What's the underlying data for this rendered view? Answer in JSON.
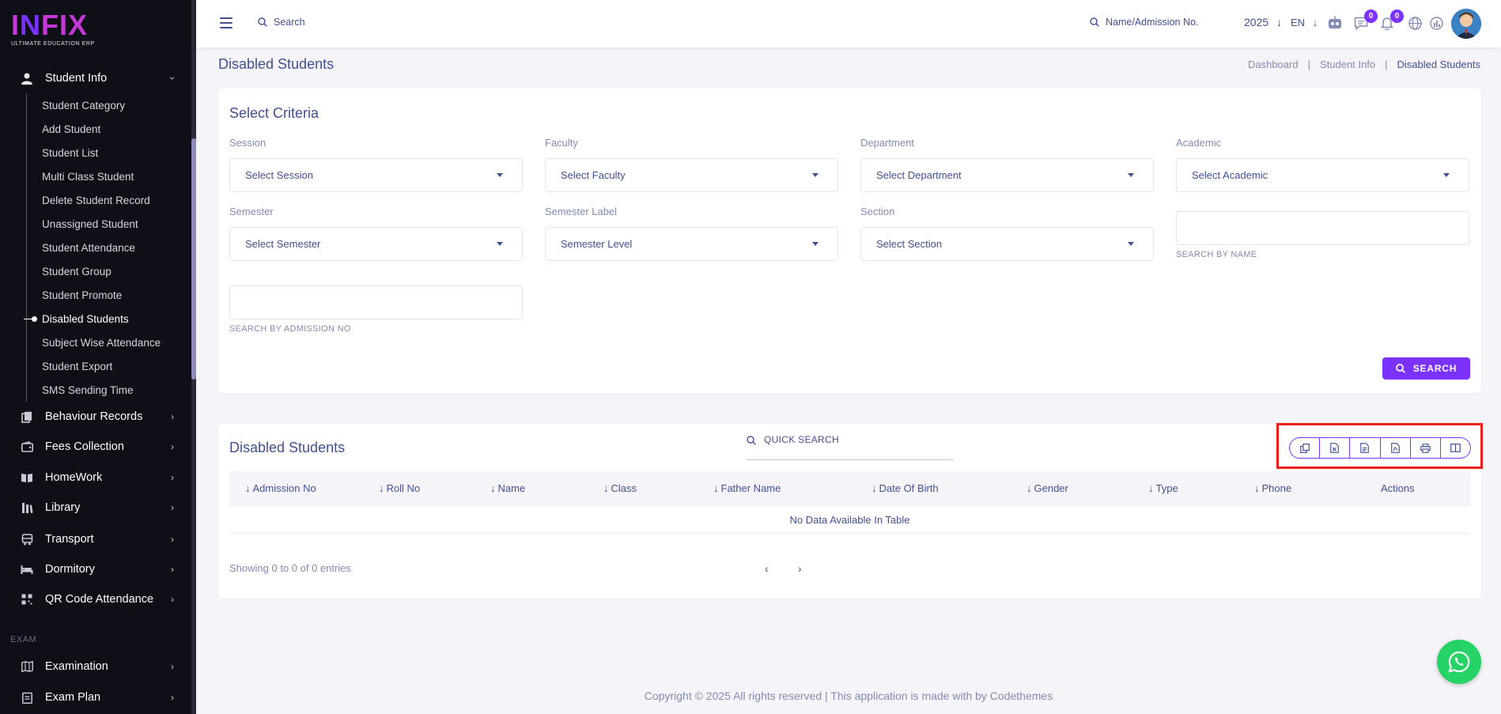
{
  "brand": {
    "logo_text": "INFIX",
    "tagline": "ULTIMATE EDUCATION ERP"
  },
  "sidebar": {
    "student_info": {
      "label": "Student Info",
      "icon": "user-icon"
    },
    "sub_items": [
      {
        "label": "Student Category"
      },
      {
        "label": "Add Student"
      },
      {
        "label": "Student List"
      },
      {
        "label": "Multi Class Student"
      },
      {
        "label": "Delete Student Record"
      },
      {
        "label": "Unassigned Student"
      },
      {
        "label": "Student Attendance"
      },
      {
        "label": "Student Group"
      },
      {
        "label": "Student Promote"
      },
      {
        "label": "Disabled Students",
        "active": true
      },
      {
        "label": "Subject Wise Attendance"
      },
      {
        "label": "Student Export"
      },
      {
        "label": "SMS Sending Time"
      }
    ],
    "menus": [
      {
        "label": "Behaviour Records",
        "icon": "copy-icon"
      },
      {
        "label": "Fees Collection",
        "icon": "wallet-icon"
      },
      {
        "label": "HomeWork",
        "icon": "book-icon"
      },
      {
        "label": "Library",
        "icon": "library-icon"
      },
      {
        "label": "Transport",
        "icon": "bus-icon"
      },
      {
        "label": "Dormitory",
        "icon": "bed-icon"
      },
      {
        "label": "QR Code Attendance",
        "icon": "qr-icon"
      }
    ],
    "section_exam": "EXAM",
    "exam_menus": [
      {
        "label": "Examination",
        "icon": "map-icon"
      },
      {
        "label": "Exam Plan",
        "icon": "clipboard-icon"
      }
    ]
  },
  "header": {
    "search_label": "Search",
    "student_search_label": "Name/Admission No.",
    "year": "2025",
    "language": "EN",
    "chat_badge": "0",
    "notification_badge": "0"
  },
  "page": {
    "title": "Disabled Students",
    "breadcrumb": [
      "Dashboard",
      "Student Info",
      "Disabled Students"
    ]
  },
  "criteria": {
    "title": "Select Criteria",
    "fields": [
      {
        "label": "Session",
        "value": "Select Session"
      },
      {
        "label": "Faculty",
        "value": "Select Faculty"
      },
      {
        "label": "Department",
        "value": "Select Department"
      },
      {
        "label": "Academic",
        "value": "Select Academic"
      },
      {
        "label": "Semester",
        "value": "Select Semester"
      },
      {
        "label": "Semester Label",
        "value": "Semester Level"
      },
      {
        "label": "Section",
        "value": "Select Section"
      }
    ],
    "search_by_name_hint": "SEARCH BY NAME",
    "search_by_admission_hint": "SEARCH BY ADMISSION NO",
    "search_button": "SEARCH"
  },
  "table": {
    "title": "Disabled Students",
    "quick_search": "QUICK SEARCH",
    "columns": [
      "Admission No",
      "Roll No",
      "Name",
      "Class",
      "Father Name",
      "Date Of Birth",
      "Gender",
      "Type",
      "Phone",
      "Actions"
    ],
    "empty_text": "No Data Available In Table",
    "showing": "Showing 0 to 0 of 0 entries",
    "tools": [
      "copy-icon",
      "excel-icon",
      "csv-icon",
      "pdf-icon",
      "print-icon",
      "columns-icon"
    ]
  },
  "footer": {
    "text": "Copyright © 2025 All rights reserved | This application is made with by Codethemes"
  },
  "colors": {
    "accent": "#7c32ff",
    "text": "#415094",
    "muted": "#828bb2",
    "sidebar": "#0f0f17",
    "highlight": "#ee1e1e",
    "whatsapp": "#25d366"
  }
}
